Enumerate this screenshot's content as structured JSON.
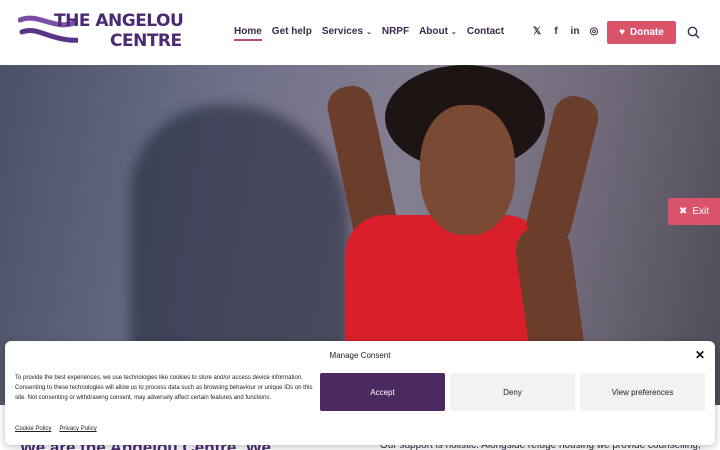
{
  "header": {
    "logo_line1": "THE ANGELOU",
    "logo_line2": "CENTRE",
    "nav": [
      {
        "label": "Home",
        "active": true,
        "has_dropdown": false
      },
      {
        "label": "Get help",
        "active": false,
        "has_dropdown": false
      },
      {
        "label": "Services",
        "active": false,
        "has_dropdown": true
      },
      {
        "label": "NRPF",
        "active": false,
        "has_dropdown": false
      },
      {
        "label": "About",
        "active": false,
        "has_dropdown": true
      },
      {
        "label": "Contact",
        "active": false,
        "has_dropdown": false
      }
    ],
    "social_icons": [
      "x-icon",
      "facebook-icon",
      "linkedin-icon",
      "instagram-icon"
    ],
    "social_glyphs": {
      "x": "𝕏",
      "facebook": "f",
      "linkedin": "in",
      "instagram": "◎"
    },
    "donate_label": "Donate",
    "brand_color": "#4b2a73",
    "accent_color": "#d9546b"
  },
  "exit_label": "Exit",
  "below_hero": {
    "heading_peek": "We are the Angelou Centre. We",
    "text_peek": "Our support is holistic. Alongside refuge housing we provide counselling,"
  },
  "consent": {
    "title": "Manage Consent",
    "body": "To provide the best experiences, we use technologies like cookies to store and/or access device information. Consenting to these technologies will allow us to process data such as browsing behaviour or unique IDs on this site. Not consenting or withdrawing consent, may adversely affect certain features and functions.",
    "accept_label": "Accept",
    "deny_label": "Deny",
    "preferences_label": "View preferences",
    "cookie_policy_label": "Cookie Policy",
    "privacy_policy_label": "Privacy Policy",
    "accept_color": "#4b2a5f"
  }
}
